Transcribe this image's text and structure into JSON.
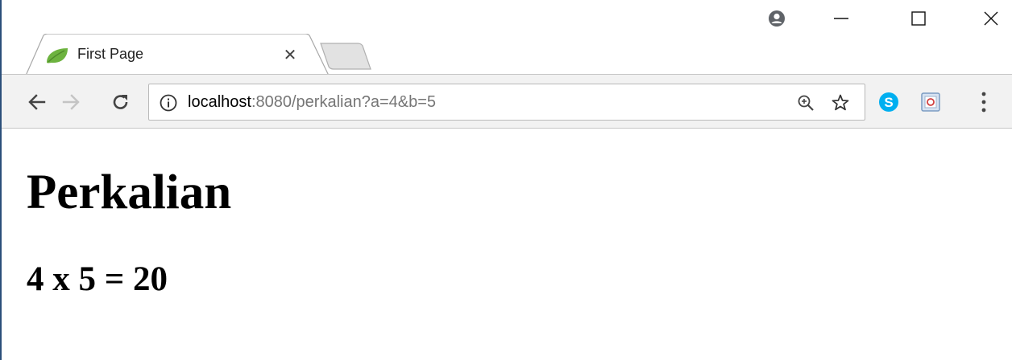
{
  "window": {
    "controls": {
      "profile_icon": "profile-icon",
      "minimize_icon": "minimize-icon",
      "maximize_icon": "maximize-icon",
      "close_icon": "close-icon"
    }
  },
  "tabs": [
    {
      "title": "First Page",
      "favicon": "leaf-icon",
      "active": true
    }
  ],
  "toolbar": {
    "back_icon": "arrow-left-icon",
    "forward_icon": "arrow-right-icon",
    "reload_icon": "reload-icon",
    "omnibox": {
      "info_icon": "info-icon",
      "url_host": "localhost",
      "url_rest": ":8080/perkalian?a=4&b=5",
      "zoom_icon": "zoom-icon",
      "star_icon": "star-icon"
    },
    "extensions": [
      "skype-icon",
      "extension-icon"
    ],
    "menu_icon": "menu-dots-icon"
  },
  "page": {
    "heading": "Perkalian",
    "result": "4 x 5 = 20"
  },
  "colors": {
    "favicon_green": "#6db33f",
    "skype_blue": "#00aff0",
    "window_border": "#2b4f7a",
    "toolbar_bg": "#f2f2f2"
  }
}
